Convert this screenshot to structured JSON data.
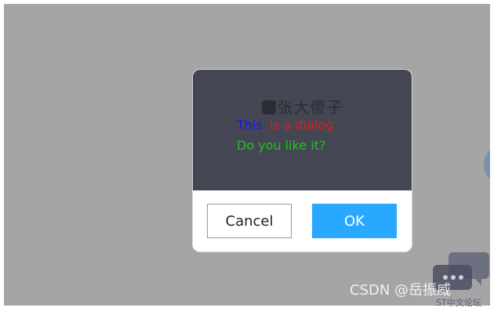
{
  "dialog": {
    "watermark": "张大傻子",
    "message_line1_part1": "This",
    "message_line1_part2": "is a dialog",
    "message_line2": "Do you like it?",
    "cancel_label": "Cancel",
    "ok_label": "OK"
  },
  "overlay": {
    "csdn_watermark": "CSDN @岳振威",
    "forum_watermark": "ST中文论坛"
  },
  "colors": {
    "background": "#a5a5a5",
    "dialog_body": "#444753",
    "this_text": "#1a1adf",
    "dialog_text": "#dc1e1e",
    "question_text": "#1fc21f",
    "ok_button": "#2aa8ff"
  }
}
